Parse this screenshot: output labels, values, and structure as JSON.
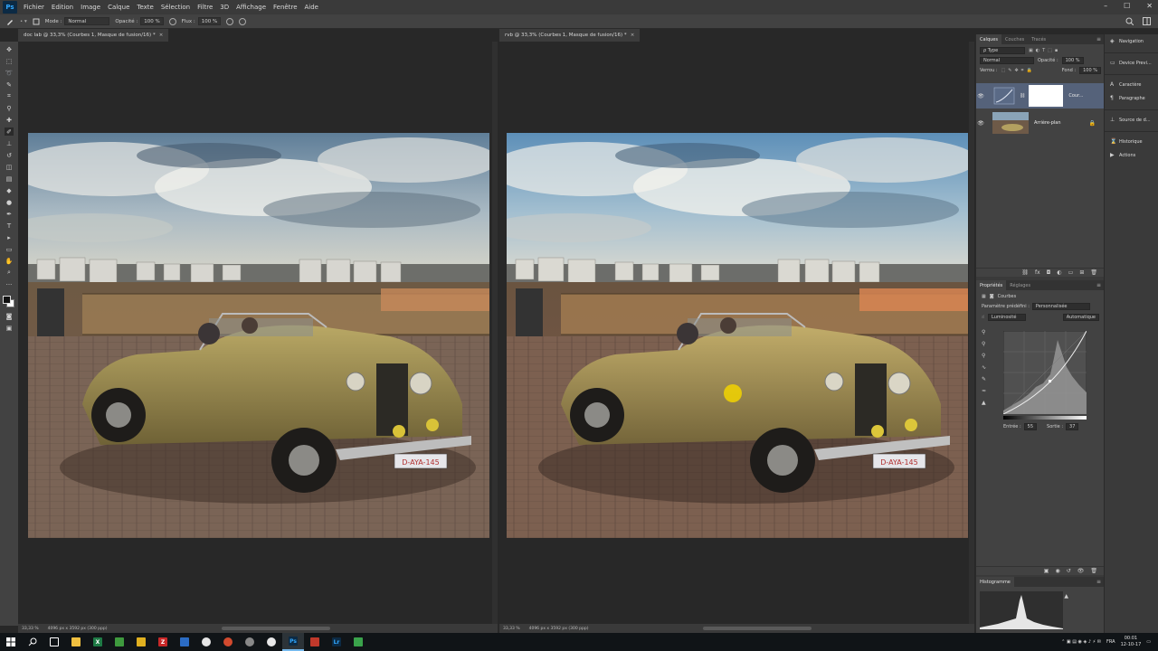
{
  "menubar": {
    "logo": "Ps",
    "items": [
      "Fichier",
      "Edition",
      "Image",
      "Calque",
      "Texte",
      "Sélection",
      "Filtre",
      "3D",
      "Affichage",
      "Fenêtre",
      "Aide"
    ],
    "win_min": "–",
    "win_max": "☐",
    "win_close": "✕"
  },
  "options_bar": {
    "mode_label": "Mode :",
    "mode_value": "Normal",
    "opacity_label": "Opacité :",
    "opacity_value": "100 %",
    "flow_label": "Flux :",
    "flow_value": "100 %"
  },
  "documents": [
    {
      "tab_title": "doc lab @ 33,3% (Courbes 1, Masque de fusion/16) *",
      "zoom": "33,33 %",
      "info": "4096 px x 3592 px (300 ppp)",
      "plate": "D-AYA-145"
    },
    {
      "tab_title": "rvb @ 33,3% (Courbes 1, Masque de fusion/16) *",
      "zoom": "33,33 %",
      "info": "4096 px x 3592 px (300 ppp)",
      "plate": "D-AYA-145"
    }
  ],
  "layers_panel": {
    "tabs": [
      "Calques",
      "Couches",
      "Tracés"
    ],
    "filter_label": "ρ Type",
    "blend_mode": "Normal",
    "opacity_label": "Opacité :",
    "opacity_value": "100 %",
    "lock_label": "Verrou :",
    "fill_label": "Fond :",
    "fill_value": "100 %",
    "layers": [
      {
        "name": "Cour...",
        "selected": true
      },
      {
        "name": "Arrière-plan",
        "selected": false
      }
    ]
  },
  "properties_panel": {
    "tabs": [
      "Propriétés",
      "Réglages"
    ],
    "title": "Courbes",
    "preset_label": "Paramètre prédéfini :",
    "preset_value": "Personnalisée",
    "channel_value": "Luminosité",
    "auto_button": "Automatique",
    "input_label": "Entrée :",
    "input_value": "55",
    "output_label": "Sortie :",
    "output_value": "37"
  },
  "histogram_panel": {
    "title": "Histogramme"
  },
  "narrow_panels": {
    "items": [
      "Navigation",
      "Device Previ...",
      "Caractère",
      "Paragraphe",
      "Source de d...",
      "Historique",
      "Actions"
    ]
  },
  "taskbar": {
    "lang": "FRA",
    "time": "00:01",
    "date": "12-10-17"
  }
}
